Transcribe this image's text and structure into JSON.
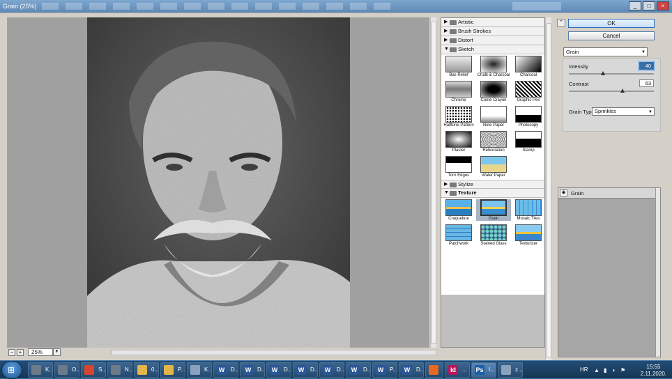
{
  "window": {
    "title": "Grain (25%)"
  },
  "preview": {
    "zoom": "25%",
    "zoom_out": "−",
    "zoom_in": "+"
  },
  "gallery": {
    "categories_top": [
      {
        "label": "Artistic",
        "expanded": false
      },
      {
        "label": "Brush Strokes",
        "expanded": false
      },
      {
        "label": "Distort",
        "expanded": false
      }
    ],
    "sketch": {
      "label": "Sketch",
      "expanded": true,
      "filters": [
        "Bas Relief",
        "Chalk & Charcoal",
        "Charcoal",
        "Chrome",
        "Conté Crayon",
        "Graphic Pen",
        "Halftone Pattern",
        "Note Paper",
        "Photocopy",
        "Plaster",
        "Reticulation",
        "Stamp",
        "Torn Edges",
        "Water Paper"
      ]
    },
    "stylize": {
      "label": "Stylize",
      "expanded": false
    },
    "texture": {
      "label": "Texture",
      "expanded": true,
      "filters": [
        "Craquelure",
        "Grain",
        "Mosaic Tiles",
        "Patchwork",
        "Stained Glass",
        "Texturizer"
      ],
      "selected": "Grain"
    }
  },
  "buttons": {
    "ok": "OK",
    "cancel": "Cancel"
  },
  "filter": {
    "selected": "Grain"
  },
  "params": {
    "intensity": {
      "label": "Intensity",
      "value": "40",
      "fraction": 0.4
    },
    "contrast": {
      "label": "Contrast",
      "value": "63",
      "fraction": 0.63
    },
    "grain_type": {
      "label": "Grain Type:",
      "value": "Sprinkles"
    }
  },
  "layers": [
    {
      "name": "Grain"
    }
  ],
  "taskbar": {
    "items": [
      {
        "label": "K...",
        "icon": "app-icon",
        "color": "#6d7a8a"
      },
      {
        "label": "O...",
        "icon": "app-icon",
        "color": "#6d7a8a"
      },
      {
        "label": "S...",
        "icon": "chrome-icon",
        "color": "#d9442f"
      },
      {
        "label": "N...",
        "icon": "app-icon",
        "color": "#6d7a8a"
      },
      {
        "label": "0...",
        "icon": "folder-icon",
        "color": "#e2b648"
      },
      {
        "label": "P...",
        "icon": "folder-icon",
        "color": "#e2b648"
      },
      {
        "label": "K...",
        "icon": "app-icon",
        "color": "#8aa2bd"
      },
      {
        "label": "D...",
        "icon": "word-icon",
        "color": "#2b5797"
      },
      {
        "label": "D...",
        "icon": "word-icon",
        "color": "#2b5797"
      },
      {
        "label": "D...",
        "icon": "word-icon",
        "color": "#2b5797"
      },
      {
        "label": "D...",
        "icon": "word-icon",
        "color": "#2b5797"
      },
      {
        "label": "D...",
        "icon": "word-icon",
        "color": "#2b5797"
      },
      {
        "label": "D...",
        "icon": "word-icon",
        "color": "#2b5797"
      },
      {
        "label": "P...",
        "icon": "word-icon",
        "color": "#2b5797"
      },
      {
        "label": "D...",
        "icon": "word-icon",
        "color": "#2b5797"
      },
      {
        "label": "",
        "icon": "firefox-icon",
        "color": "#e66a1f"
      },
      {
        "label": "...",
        "icon": "indesign-icon",
        "color": "#b3185a"
      },
      {
        "label": "I...",
        "icon": "photoshop-icon",
        "color": "#1d5fa8"
      },
      {
        "label": "z...",
        "icon": "app-icon",
        "color": "#8aa2bd"
      }
    ],
    "letters": [
      "",
      "",
      "",
      "",
      "",
      "",
      "",
      "W",
      "W",
      "W",
      "W",
      "W",
      "W",
      "W",
      "W",
      "",
      "Id",
      "Ps",
      ""
    ],
    "lang": "HR",
    "time": "15:55",
    "date": "2.11.2020."
  },
  "colors": {
    "accent": "#3a6ea5",
    "titlebar": "#6b93bd",
    "taskbar": "#1d4166"
  }
}
